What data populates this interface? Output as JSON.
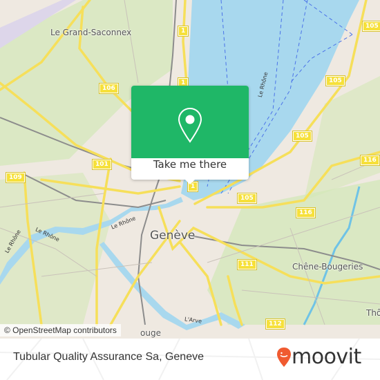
{
  "map": {
    "places": {
      "grand_saconnex": "Le Grand-Saconnex",
      "geneve": "Genève",
      "chene_bougeries": "Chêne-Bougeries",
      "thonex_partial": "Thô",
      "carouge_partial": "ouge"
    },
    "rivers": {
      "rhone_lake": "Le Rhône",
      "rhone_1": "Le Rhône",
      "rhone_2": "Le Rhône",
      "rhone_3": "Le Rhône",
      "arve": "L'Arve"
    },
    "road_shields": {
      "r1_top": "1",
      "r1_mid": "1",
      "r1_bottom": "1",
      "r105_top": "105",
      "r105_mid": "105",
      "r105_low": "105",
      "r105_bottom": "105",
      "r106": "106",
      "r101": "101",
      "r109": "109",
      "r116_top": "116",
      "r116_bottom": "116",
      "r111": "111",
      "r112": "112"
    },
    "attribution": "© OpenStreetMap contributors",
    "colors": {
      "water": "#a8d8ee",
      "land": "#efe9e1",
      "park": "#cfe8b0",
      "road": "#f6df5a",
      "popup_green": "#1fb767"
    }
  },
  "popup": {
    "icon": "location-pin-icon",
    "button_label": "Take me there"
  },
  "footer": {
    "title": "Tubular Quality Assurance Sa, Geneve",
    "brand": "moovit",
    "brand_color": "#f05a30"
  }
}
